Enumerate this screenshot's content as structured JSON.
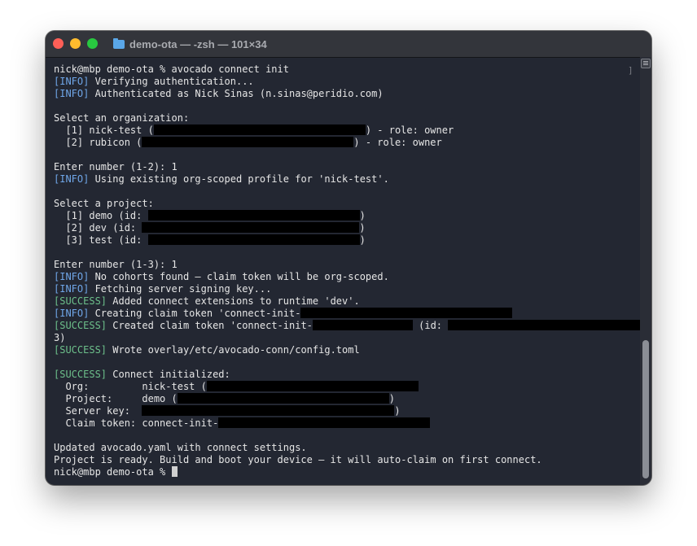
{
  "window": {
    "title": "demo-ota — -zsh — 101×34",
    "background": "#232732",
    "info_color": "#6fa6e8",
    "success_color": "#6dc08b"
  },
  "terminal": {
    "lines": [
      {
        "segments": [
          {
            "t": "nick@mbp demo-ota % avocado connect init"
          }
        ]
      },
      {
        "segments": [
          {
            "t": "[INFO]",
            "c": "info"
          },
          {
            "t": " Verifying authentication..."
          }
        ]
      },
      {
        "segments": [
          {
            "t": "[INFO]",
            "c": "info"
          },
          {
            "t": " Authenticated as Nick Sinas (n.sinas@peridio.com)"
          }
        ]
      },
      {
        "segments": []
      },
      {
        "segments": [
          {
            "t": "Select an organization:"
          }
        ]
      },
      {
        "segments": [
          {
            "t": "  [1] nick-test ("
          },
          {
            "redact": 36
          },
          {
            "t": ") - role: owner"
          }
        ]
      },
      {
        "segments": [
          {
            "t": "  [2] rubicon ("
          },
          {
            "redact": 36
          },
          {
            "t": ") - role: owner"
          }
        ]
      },
      {
        "segments": []
      },
      {
        "segments": [
          {
            "t": "Enter number (1-2): 1"
          }
        ]
      },
      {
        "segments": [
          {
            "t": "[INFO]",
            "c": "info"
          },
          {
            "t": " Using existing org-scoped profile for 'nick-test'."
          }
        ]
      },
      {
        "segments": []
      },
      {
        "segments": [
          {
            "t": "Select a project:"
          }
        ]
      },
      {
        "segments": [
          {
            "t": "  [1] demo (id: "
          },
          {
            "redact": 36
          },
          {
            "t": ")"
          }
        ]
      },
      {
        "segments": [
          {
            "t": "  [2] dev (id: "
          },
          {
            "redact": 37
          },
          {
            "t": ")"
          }
        ]
      },
      {
        "segments": [
          {
            "t": "  [3] test (id: "
          },
          {
            "redact": 36
          },
          {
            "t": ")"
          }
        ]
      },
      {
        "segments": []
      },
      {
        "segments": [
          {
            "t": "Enter number (1-3): 1"
          }
        ]
      },
      {
        "segments": [
          {
            "t": "[INFO]",
            "c": "info"
          },
          {
            "t": " No cohorts found — claim token will be org-scoped."
          }
        ]
      },
      {
        "segments": [
          {
            "t": "[INFO]",
            "c": "info"
          },
          {
            "t": " Fetching server signing key..."
          }
        ]
      },
      {
        "segments": [
          {
            "t": "[SUCCESS]",
            "c": "succ"
          },
          {
            "t": " Added connect extensions to runtime 'dev'."
          }
        ]
      },
      {
        "segments": [
          {
            "t": "[INFO]",
            "c": "info"
          },
          {
            "t": " Creating claim token 'connect-init-"
          },
          {
            "redact": 36
          }
        ]
      },
      {
        "segments": [
          {
            "t": "[SUCCESS]",
            "c": "succ"
          },
          {
            "t": " Created claim token 'connect-init-"
          },
          {
            "redact": 17
          },
          {
            "t": " (id: "
          },
          {
            "redact": 36
          }
        ]
      },
      {
        "segments": [
          {
            "t": "3)"
          }
        ]
      },
      {
        "segments": [
          {
            "t": "[SUCCESS]",
            "c": "succ"
          },
          {
            "t": " Wrote overlay/etc/avocado-conn/config.toml"
          }
        ]
      },
      {
        "segments": []
      },
      {
        "segments": [
          {
            "t": "[SUCCESS]",
            "c": "succ"
          },
          {
            "t": " Connect initialized:"
          }
        ]
      },
      {
        "segments": [
          {
            "t": "  Org:         nick-test ("
          },
          {
            "redact": 36
          }
        ]
      },
      {
        "segments": [
          {
            "t": "  Project:     demo ("
          },
          {
            "redact": 36
          },
          {
            "t": ")"
          }
        ]
      },
      {
        "segments": [
          {
            "t": "  Server key:  "
          },
          {
            "redact": 43
          },
          {
            "t": ")"
          }
        ]
      },
      {
        "segments": [
          {
            "t": "  Claim token: connect-init-"
          },
          {
            "redact": 36
          }
        ]
      },
      {
        "segments": []
      },
      {
        "segments": [
          {
            "t": "Updated avocado.yaml with connect settings."
          }
        ]
      },
      {
        "segments": [
          {
            "t": "Project is ready. Build and boot your device — it will auto-claim on first connect."
          }
        ]
      },
      {
        "segments": [
          {
            "t": "nick@mbp demo-ota % "
          },
          {
            "cursor": true
          }
        ]
      }
    ]
  }
}
